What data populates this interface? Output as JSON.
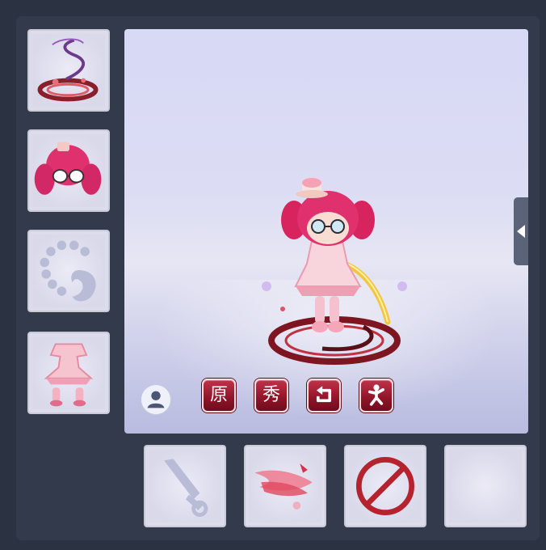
{
  "equipment_left": [
    {
      "slot": "mount-effect",
      "icon": "dark-swirl-ring-icon",
      "empty": false
    },
    {
      "slot": "hair",
      "icon": "pink-twintail-hair-icon",
      "empty": false
    },
    {
      "slot": "accessory",
      "icon": "necklace-placeholder-icon",
      "empty": true
    },
    {
      "slot": "outfit",
      "icon": "pink-dress-outfit-icon",
      "empty": false
    }
  ],
  "equipment_bottom": [
    {
      "slot": "weapon",
      "icon": "sword-placeholder-icon",
      "empty": true
    },
    {
      "slot": "effect",
      "icon": "pink-wing-effect-icon",
      "empty": false
    },
    {
      "slot": "disabled",
      "icon": "prohibited-icon",
      "empty": false
    },
    {
      "slot": "blank",
      "icon": "",
      "empty": true
    }
  ],
  "controls": {
    "original_label": "原",
    "show_label": "秀",
    "rotate_icon": "rotate-icon",
    "action_icon": "dance-pose-icon",
    "avatar_icon": "person-icon"
  },
  "colors": {
    "button_red": "#a01c33",
    "panel_bg": "#323a4b",
    "viewer_bg": "#d7d9f5"
  }
}
